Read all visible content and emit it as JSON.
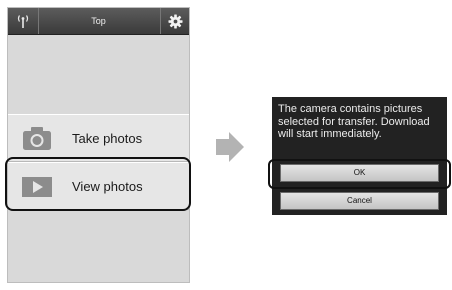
{
  "top_bar": {
    "title": "Top",
    "wifi_icon": "wifi-antenna-icon",
    "settings_icon": "gear-icon"
  },
  "menu": {
    "take_photos": {
      "label": "Take photos",
      "icon": "camera-icon"
    },
    "view_photos": {
      "label": "View photos",
      "icon": "play-icon",
      "highlighted": true
    }
  },
  "transition_icon": "arrow-right-icon",
  "dialog": {
    "message": "The camera contains pictures selected for transfer. Download will start immediately.",
    "ok_label": "OK",
    "cancel_label": "Cancel",
    "highlighted_button": "OK"
  },
  "colors": {
    "top_bar": "#4a4a4a",
    "screen_background": "#d9d9d9",
    "dialog_background": "#222222",
    "highlight_ring": "#111111",
    "arrow": "#b3b3b3"
  }
}
